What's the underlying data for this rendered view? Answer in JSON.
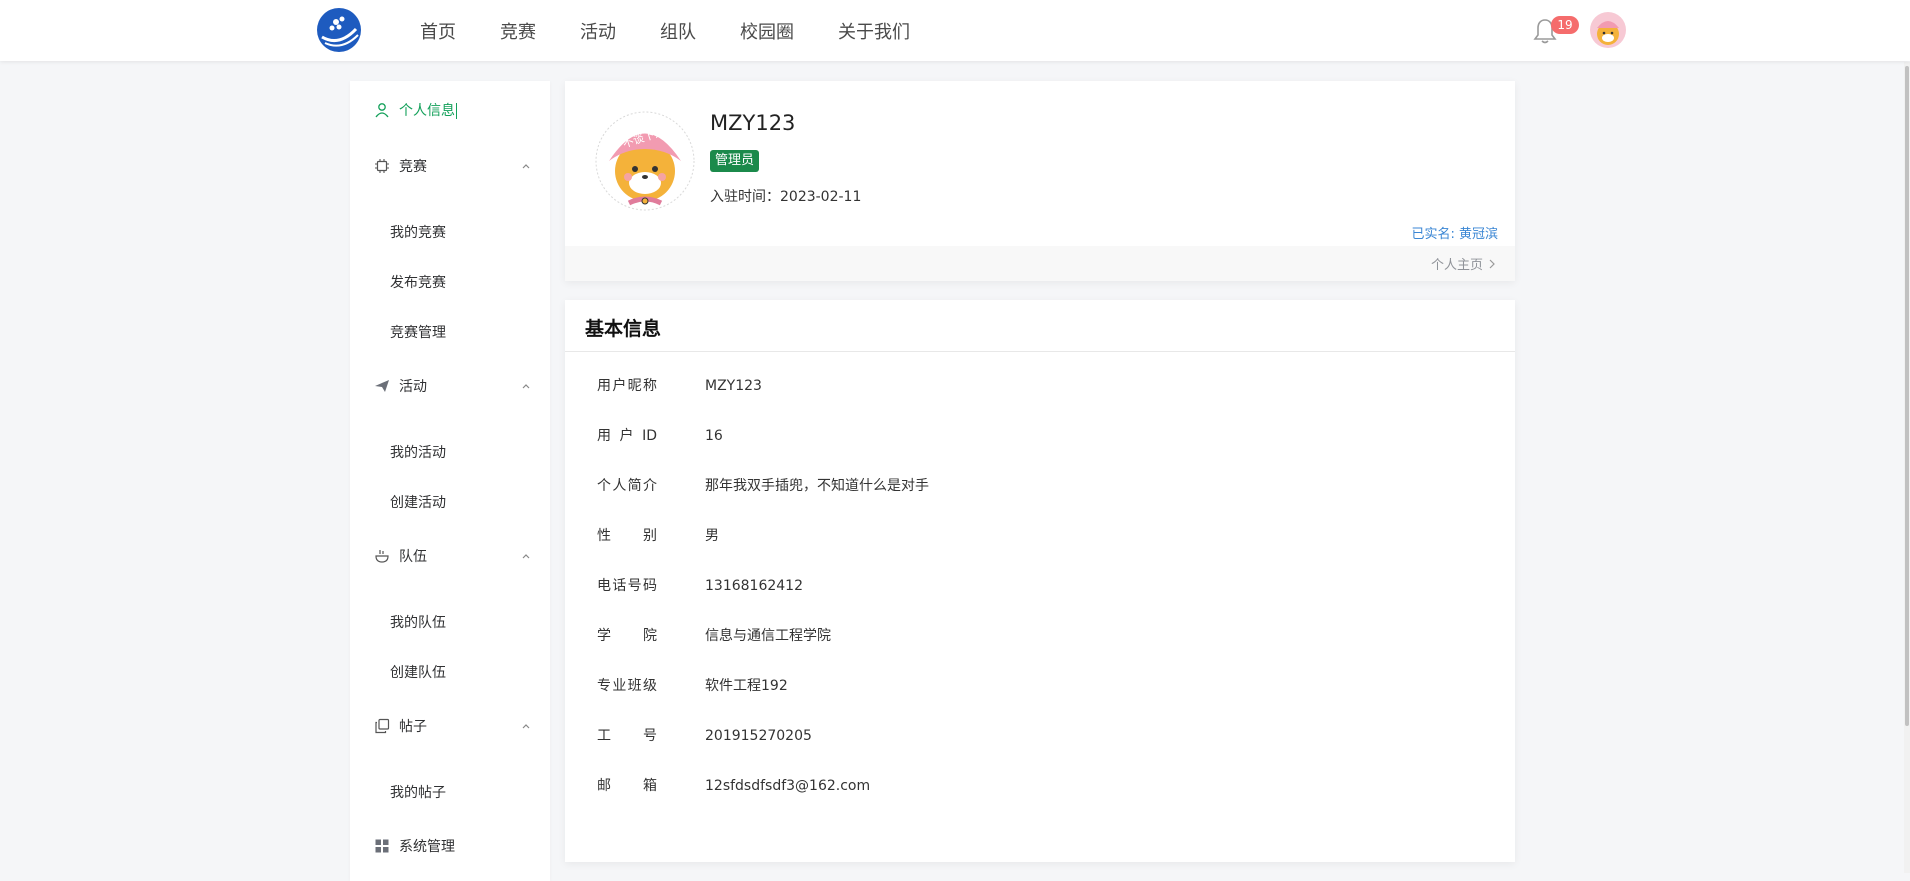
{
  "nav": {
    "items": [
      "首页",
      "竞赛",
      "活动",
      "组队",
      "校园圈",
      "关于我们"
    ],
    "notification_count": "19"
  },
  "sidebar": {
    "profile": "个人信息",
    "competition": {
      "label": "竞赛",
      "items": [
        "我的竞赛",
        "发布竞赛",
        "竞赛管理"
      ]
    },
    "activity": {
      "label": "活动",
      "items": [
        "我的活动",
        "创建活动"
      ]
    },
    "team": {
      "label": "队伍",
      "items": [
        "我的队伍",
        "创建队伍"
      ]
    },
    "post": {
      "label": "帖子",
      "items": [
        "我的帖子"
      ]
    },
    "system": "系统管理"
  },
  "profile": {
    "username": "MZY123",
    "role": "管理员",
    "joined": "入驻时间：2023-02-11",
    "realname": "已实名: 黄冠滨",
    "homepage": "个人主页",
    "avatar_text": "不谈下凡"
  },
  "info": {
    "title": "基本信息",
    "rows": [
      {
        "label": "用户昵称",
        "value": "MZY123"
      },
      {
        "label": "用户ID",
        "value": "16"
      },
      {
        "label": "个人简介",
        "value": "那年我双手插兜，不知道什么是对手"
      },
      {
        "label": "性别",
        "value": "男"
      },
      {
        "label": "电话号码",
        "value": "13168162412"
      },
      {
        "label": "学院",
        "value": "信息与通信工程学院"
      },
      {
        "label": "专业班级",
        "value": "软件工程192"
      },
      {
        "label": "工号",
        "value": "201915270205"
      },
      {
        "label": "邮箱",
        "value": "12sfdsdfsdf3@162.com"
      }
    ]
  },
  "colors": {
    "accent": "#13a05a",
    "role_badge": "#1b8a4b",
    "link": "#3a86d4",
    "badge": "#f56c6c"
  }
}
